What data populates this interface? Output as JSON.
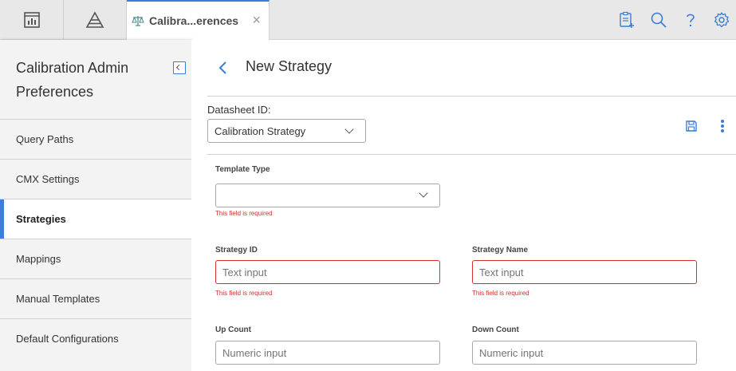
{
  "tab": {
    "label": "Calibra...erences"
  },
  "sidebar": {
    "title": "Calibration Admin Preferences",
    "items": [
      {
        "label": "Query Paths"
      },
      {
        "label": "CMX Settings"
      },
      {
        "label": "Strategies"
      },
      {
        "label": "Mappings"
      },
      {
        "label": "Manual Templates"
      },
      {
        "label": "Default Configurations"
      }
    ]
  },
  "main": {
    "title": "New Strategy",
    "datasheet": {
      "label": "Datasheet ID:",
      "value": "Calibration Strategy"
    },
    "fields": {
      "template_type": {
        "label": "Template Type",
        "value": "",
        "error": "This field is required"
      },
      "strategy_id": {
        "label": "Strategy ID",
        "placeholder": "Text input",
        "error": "This field is required"
      },
      "strategy_name": {
        "label": "Strategy Name",
        "placeholder": "Text input",
        "error": "This field is required"
      },
      "up_count": {
        "label": "Up Count",
        "placeholder": "Numeric input"
      },
      "down_count": {
        "label": "Down Count",
        "placeholder": "Numeric input"
      }
    }
  },
  "colors": {
    "accent": "#3b7dd8",
    "error": "#d32f2f"
  }
}
